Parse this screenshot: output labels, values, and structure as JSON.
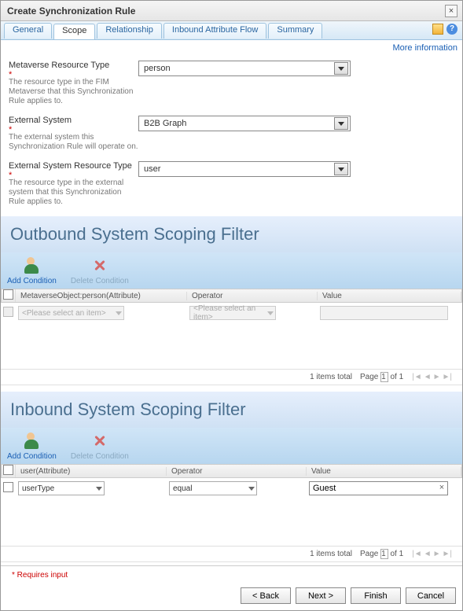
{
  "dialog": {
    "title": "Create Synchronization Rule",
    "more_info": "More information",
    "required_note": "* Requires input"
  },
  "tabs": [
    "General",
    "Scope",
    "Relationship",
    "Inbound Attribute Flow",
    "Summary"
  ],
  "active_tab_index": 1,
  "fields": {
    "metaverse_type": {
      "label": "Metaverse Resource Type",
      "help": "The resource type in the FIM Metaverse that this Synchronization Rule applies to.",
      "value": "person"
    },
    "external_system": {
      "label": "External System",
      "help": "The external system this Synchronization Rule will operate on.",
      "value": "B2B Graph"
    },
    "external_type": {
      "label": "External System Resource Type",
      "help": "The resource type in the external system that this Synchronization Rule applies to.",
      "value": "user"
    }
  },
  "outbound": {
    "heading": "Outbound System Scoping Filter",
    "add_label": "Add Condition",
    "delete_label": "Delete Condition",
    "cols": {
      "attr": "MetaverseObject:person(Attribute)",
      "op": "Operator",
      "val": "Value"
    },
    "placeholder": "<Please select an item>",
    "pager": {
      "items": "1 items total",
      "page_lbl": "Page",
      "of": "of 1",
      "num": "1"
    }
  },
  "inbound": {
    "heading": "Inbound System Scoping Filter",
    "add_label": "Add Condition",
    "delete_label": "Delete Condition",
    "cols": {
      "attr": "user(Attribute)",
      "op": "Operator",
      "val": "Value"
    },
    "row": {
      "attr": "userType",
      "op": "equal",
      "val": "Guest"
    },
    "pager": {
      "items": "1 items total",
      "page_lbl": "Page",
      "of": "of 1",
      "num": "1"
    }
  },
  "buttons": {
    "back": "< Back",
    "next": "Next >",
    "finish": "Finish",
    "cancel": "Cancel"
  }
}
